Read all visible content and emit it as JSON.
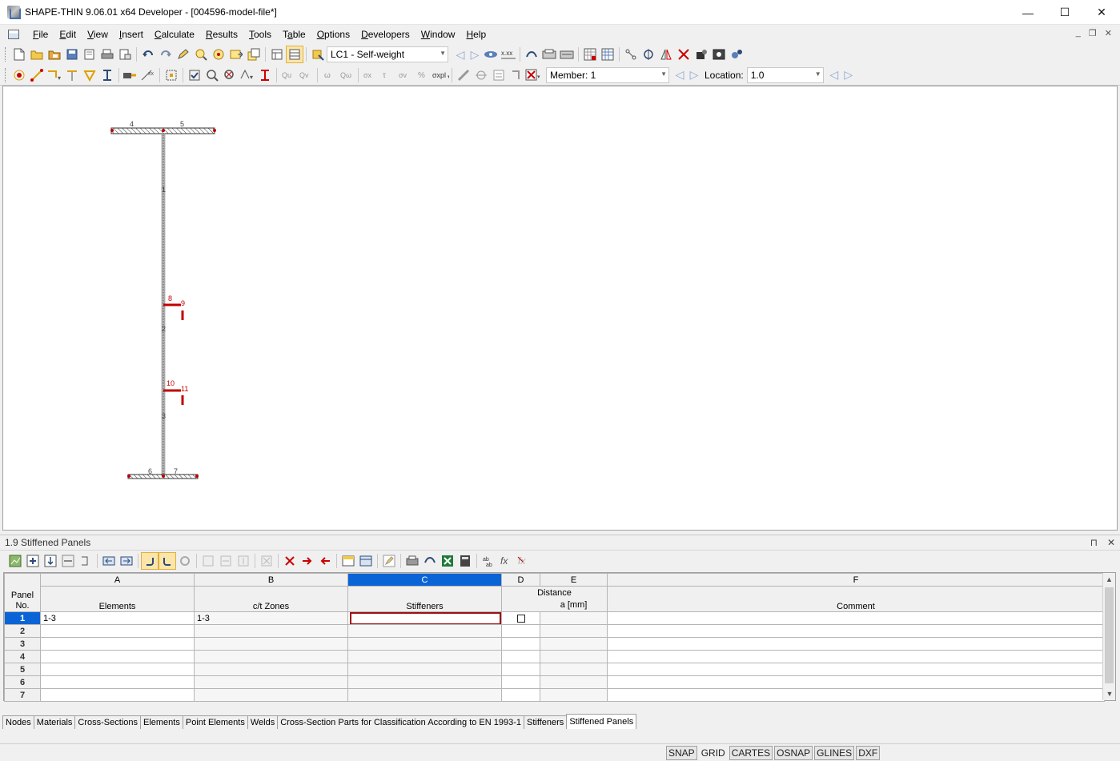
{
  "window": {
    "title": "SHAPE-THIN 9.06.01 x64 Developer - [004596-model-file*]",
    "controls": {
      "minimize": "—",
      "maximize": "☐",
      "close": "✕"
    }
  },
  "menubar": {
    "items": [
      {
        "pre": "",
        "ul": "F",
        "post": "ile"
      },
      {
        "pre": "",
        "ul": "E",
        "post": "dit"
      },
      {
        "pre": "",
        "ul": "V",
        "post": "iew"
      },
      {
        "pre": "",
        "ul": "I",
        "post": "nsert"
      },
      {
        "pre": "",
        "ul": "C",
        "post": "alculate"
      },
      {
        "pre": "",
        "ul": "R",
        "post": "esults"
      },
      {
        "pre": "",
        "ul": "T",
        "post": "ools"
      },
      {
        "pre": "T",
        "ul": "a",
        "post": "ble"
      },
      {
        "pre": "",
        "ul": "O",
        "post": "ptions"
      },
      {
        "pre": "",
        "ul": "D",
        "post": "evelopers"
      },
      {
        "pre": "",
        "ul": "W",
        "post": "indow"
      },
      {
        "pre": "",
        "ul": "H",
        "post": "elp"
      }
    ],
    "mdi": {
      "minimize": "_",
      "restore": "❐",
      "close": "✕"
    }
  },
  "toolbar1": {
    "loadcase": "LC1 - Self-weight",
    "prev": "◁",
    "next": "▷"
  },
  "toolbar2": {
    "member_label": "Member: 1",
    "location_label": "Location:",
    "location_value": "1.0",
    "prev": "◁",
    "next": "▷"
  },
  "model": {
    "nodes": [
      "4",
      "5",
      "1",
      "8",
      "9",
      "2",
      "10",
      "11",
      "3",
      "6",
      "7"
    ]
  },
  "panel": {
    "title": "1.9 Stiffened Panels",
    "pin": "⊓",
    "close": "✕"
  },
  "table": {
    "col_letters": [
      "A",
      "B",
      "C",
      "D",
      "E",
      "F"
    ],
    "header": {
      "panel_no": "Panel\nNo.",
      "elements": "Elements",
      "ct_zones": "c/t Zones",
      "stiffeners": "Stiffeners",
      "distance": "Distance",
      "a_mm": "a [mm]",
      "comment": "Comment"
    },
    "rows": [
      {
        "no": "1",
        "elements": "1-3",
        "ct_zones": "1-3",
        "stiffeners": "",
        "d": "",
        "a": "",
        "comment": ""
      },
      {
        "no": "2",
        "elements": "",
        "ct_zones": "",
        "stiffeners": "",
        "d": "",
        "a": "",
        "comment": ""
      },
      {
        "no": "3",
        "elements": "",
        "ct_zones": "",
        "stiffeners": "",
        "d": "",
        "a": "",
        "comment": ""
      },
      {
        "no": "4",
        "elements": "",
        "ct_zones": "",
        "stiffeners": "",
        "d": "",
        "a": "",
        "comment": ""
      },
      {
        "no": "5",
        "elements": "",
        "ct_zones": "",
        "stiffeners": "",
        "d": "",
        "a": "",
        "comment": ""
      },
      {
        "no": "6",
        "elements": "",
        "ct_zones": "",
        "stiffeners": "",
        "d": "",
        "a": "",
        "comment": ""
      },
      {
        "no": "7",
        "elements": "",
        "ct_zones": "",
        "stiffeners": "",
        "d": "",
        "a": "",
        "comment": ""
      }
    ]
  },
  "tabs": [
    "Nodes",
    "Materials",
    "Cross-Sections",
    "Elements",
    "Point Elements",
    "Welds",
    "Cross-Section Parts for Classification According to EN 1993-1",
    "Stiffeners",
    "Stiffened Panels"
  ],
  "active_tab": "Stiffened Panels",
  "statusbar": {
    "toggles": [
      "SNAP",
      "GRID",
      "CARTES",
      "OSNAP",
      "GLINES",
      "DXF"
    ],
    "on": [
      "GRID"
    ]
  },
  "colors": {
    "selection": "#0a64d6",
    "highlight_border": "#a01010",
    "node_red": "#c00000"
  }
}
